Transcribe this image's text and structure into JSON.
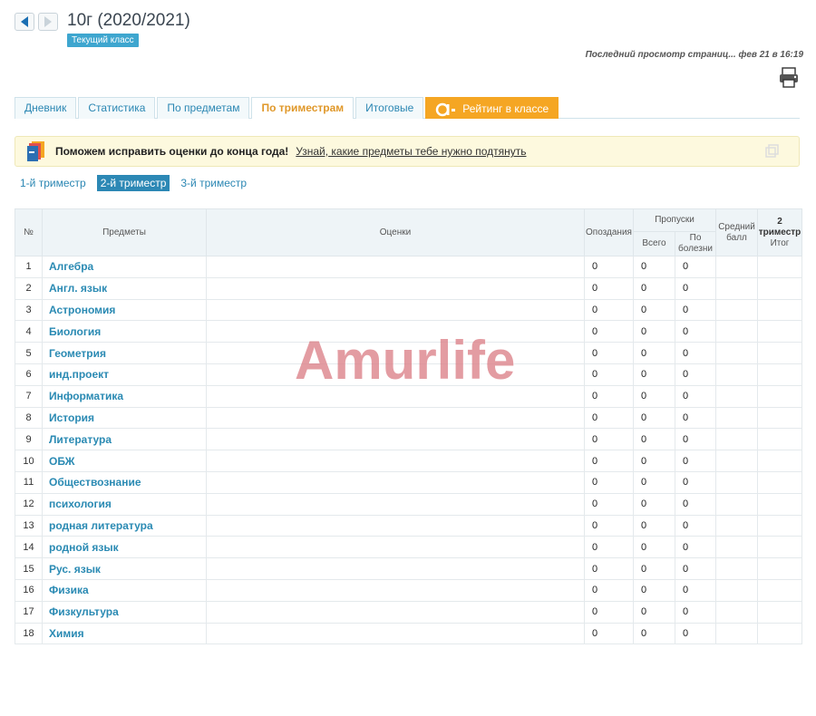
{
  "header": {
    "class_title": "10г (2020/2021)",
    "class_badge": "Текущий класс",
    "last_view": "Последний просмотр страниц... фев 21 в 16:19"
  },
  "tabs": [
    {
      "label": "Дневник"
    },
    {
      "label": "Статистика"
    },
    {
      "label": "По предметам"
    },
    {
      "label": "По триместрам"
    },
    {
      "label": "Итоговые"
    },
    {
      "label": "Рейтинг в классе"
    }
  ],
  "banner": {
    "text": "Поможем исправить оценки до конца года!",
    "link": "Узнай, какие предметы тебе нужно подтянуть"
  },
  "trimesters": [
    {
      "label": "1-й триместр"
    },
    {
      "label": "2-й триместр"
    },
    {
      "label": "3-й триместр"
    }
  ],
  "table": {
    "headers": {
      "num": "№",
      "subjects": "Предметы",
      "grades": "Оценки",
      "late": "Опоздания",
      "absences": "Пропуски",
      "total": "Всего",
      "sick": "По болезни",
      "avg": "Средний балл",
      "trimester": "2 триместр",
      "result": "Итог"
    },
    "rows": [
      {
        "num": "1",
        "subject": "Алгебра",
        "late": "0",
        "total": "0",
        "sick": "0"
      },
      {
        "num": "2",
        "subject": "Англ. язык",
        "late": "0",
        "total": "0",
        "sick": "0"
      },
      {
        "num": "3",
        "subject": "Астрономия",
        "late": "0",
        "total": "0",
        "sick": "0"
      },
      {
        "num": "4",
        "subject": "Биология",
        "late": "0",
        "total": "0",
        "sick": "0"
      },
      {
        "num": "5",
        "subject": "Геометрия",
        "late": "0",
        "total": "0",
        "sick": "0"
      },
      {
        "num": "6",
        "subject": "инд.проект",
        "late": "0",
        "total": "0",
        "sick": "0"
      },
      {
        "num": "7",
        "subject": "Информатика",
        "late": "0",
        "total": "0",
        "sick": "0"
      },
      {
        "num": "8",
        "subject": "История",
        "late": "0",
        "total": "0",
        "sick": "0"
      },
      {
        "num": "9",
        "subject": "Литература",
        "late": "0",
        "total": "0",
        "sick": "0"
      },
      {
        "num": "10",
        "subject": "ОБЖ",
        "late": "0",
        "total": "0",
        "sick": "0"
      },
      {
        "num": "11",
        "subject": "Обществознание",
        "late": "0",
        "total": "0",
        "sick": "0"
      },
      {
        "num": "12",
        "subject": "психология",
        "late": "0",
        "total": "0",
        "sick": "0"
      },
      {
        "num": "13",
        "subject": "родная литература",
        "late": "0",
        "total": "0",
        "sick": "0"
      },
      {
        "num": "14",
        "subject": "родной язык",
        "late": "0",
        "total": "0",
        "sick": "0"
      },
      {
        "num": "15",
        "subject": "Рус. язык",
        "late": "0",
        "total": "0",
        "sick": "0"
      },
      {
        "num": "16",
        "subject": "Физика",
        "late": "0",
        "total": "0",
        "sick": "0"
      },
      {
        "num": "17",
        "subject": "Физкультура",
        "late": "0",
        "total": "0",
        "sick": "0"
      },
      {
        "num": "18",
        "subject": "Химия",
        "late": "0",
        "total": "0",
        "sick": "0"
      }
    ]
  },
  "watermark": "Amurlife",
  "colors": {
    "accent_blue": "#2c88b5",
    "active_tab": "#e0982a",
    "rating_tab": "#f5a623",
    "banner_bg": "#fdf9de"
  }
}
